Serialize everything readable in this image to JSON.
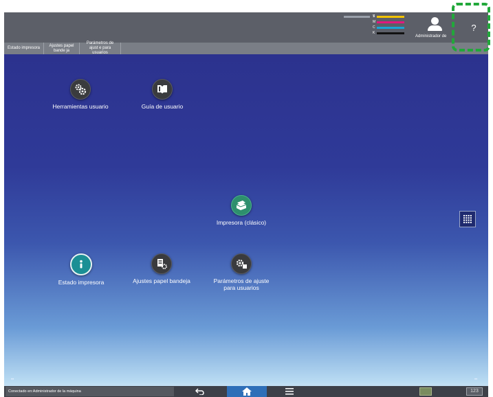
{
  "toner": [
    {
      "label": "S",
      "color": ""
    },
    {
      "label": "Y",
      "color": "#f2c300"
    },
    {
      "label": "M",
      "color": "#e2177d"
    },
    {
      "label": "C",
      "color": "#19a6d8"
    },
    {
      "label": "K",
      "color": "#111111"
    }
  ],
  "header": {
    "admin_label": "Administrador de",
    "help_label": "?"
  },
  "tabs": [
    {
      "label": "Estado impresora"
    },
    {
      "label": "Ajustes papel bande ja"
    },
    {
      "label": "Parámetros de ajust e para usuarios"
    }
  ],
  "apps": {
    "tools": {
      "label": "Herramientas usuario",
      "icon": "gears-icon"
    },
    "guide": {
      "label": "Guía de usuario",
      "icon": "book-icon"
    },
    "printer": {
      "label": "Impresora (clásico)",
      "icon": "printer-icon"
    },
    "status": {
      "label": "Estado impresora",
      "icon": "info-icon"
    },
    "tray": {
      "label": "Ajustes papel bandeja",
      "icon": "tray-settings-icon"
    },
    "params": {
      "label": "Parámetros de ajuste para usuarios",
      "icon": "user-settings-icon"
    }
  },
  "bottom": {
    "status_text": "Conectado en:Administrador de la máquina",
    "numkeys_label": "123",
    "left_dots": "••",
    "right_dots": "••"
  },
  "colors": {
    "accent_highlight": "#21a83a",
    "home_button": "#2e6fb8",
    "printer_icon": "#2e8f6d",
    "info_icon": "#1b8f95"
  }
}
